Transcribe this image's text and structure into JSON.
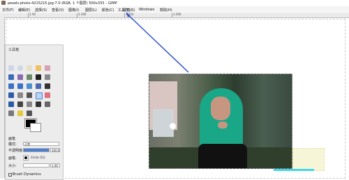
{
  "window": {
    "title": "pexels-photo-4215215.jpg-7.0 (RGB, 1 个图层) 500x333 – GIMP"
  },
  "menubar": [
    "文件(F)",
    "编辑(E)",
    "选择(S)",
    "查看(V)",
    "图像(I)",
    "图层(L)",
    "颜色(C)",
    "工具(T)",
    "滤镜(R)",
    "Windows",
    "帮助(H)"
  ],
  "ruler": {
    "labels": [
      "1.50",
      "1.100",
      "1.150",
      "1.200"
    ]
  },
  "toolbox": {
    "title": "工具箱",
    "options": {
      "header": "画笔",
      "mode_label": "模式:",
      "mode_value": "正常",
      "opacity_label": "不透明度:",
      "opacity_value": "100.0",
      "opacity_fraction": 1.0,
      "brush_label": "画笔:",
      "brush_value": "Circle (11)",
      "size_label": "大小:",
      "size_value": "1.00",
      "dynamics_label": "Brush Dynamics"
    }
  },
  "colors": {
    "toolbox_bg": "#ececec",
    "hijab": "#1aa787",
    "arrow": "#3355cc",
    "accent": "#4a7fd6"
  }
}
